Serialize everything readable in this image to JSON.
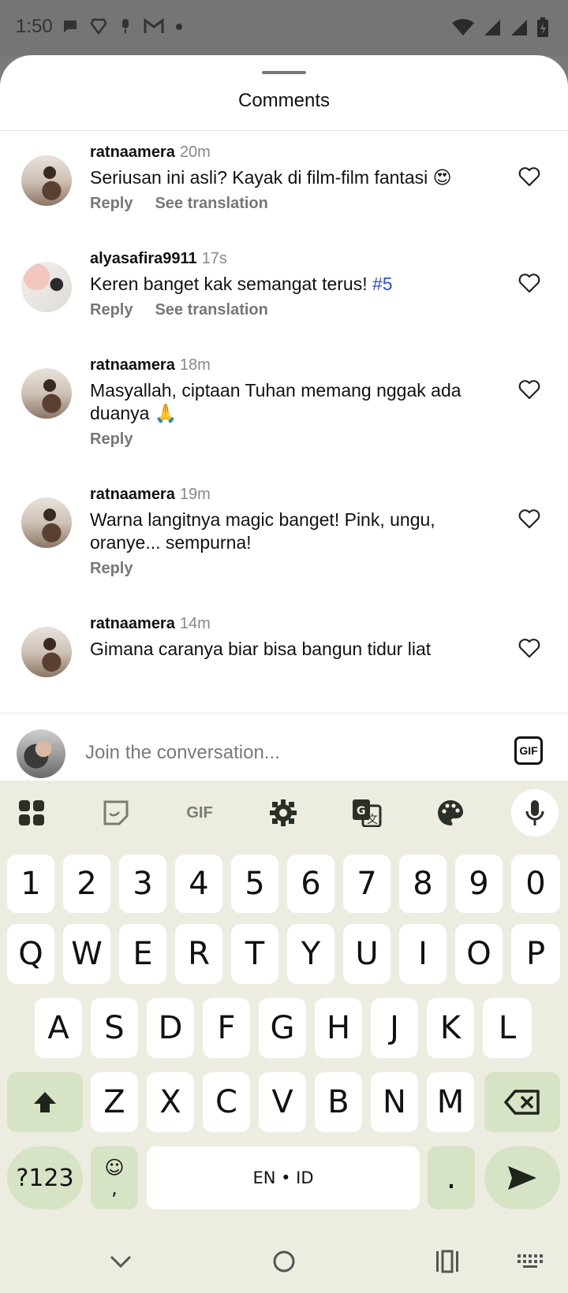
{
  "status_bar": {
    "time": "1:50",
    "left_icons": [
      "chat-bubble-icon",
      "brave-icon",
      "mic-notif-icon",
      "gmail-icon",
      "dot-icon"
    ],
    "right_icons": [
      "wifi-icon",
      "signal-icon",
      "signal-icon",
      "battery-icon"
    ]
  },
  "sheet": {
    "title": "Comments"
  },
  "comments": [
    {
      "user": "ratnaamera",
      "time": "20m",
      "text": "Seriusan ini asli? Kayak di film-film fantasi 😍",
      "reply": "Reply",
      "translate": "See translation"
    },
    {
      "user": "alyasafira9911",
      "time": "17s",
      "text": "Keren banget kak semangat terus! ",
      "hashtag": "#5",
      "reply": "Reply",
      "translate": "See translation"
    },
    {
      "user": "ratnaamera",
      "time": "18m",
      "text": "Masyallah, ciptaan Tuhan memang nggak ada duanya 🙏",
      "reply": "Reply"
    },
    {
      "user": "ratnaamera",
      "time": "19m",
      "text": "Warna langitnya magic banget! Pink, ungu, oranye... sempurna!",
      "reply": "Reply"
    },
    {
      "user": "ratnaamera",
      "time": "14m",
      "text": "Gimana caranya biar bisa bangun tidur liat"
    }
  ],
  "emoji_bar": [
    "❤️",
    "🙌",
    "🔥",
    "👏",
    "😢",
    "😍",
    "😮",
    "😂"
  ],
  "input": {
    "placeholder": "Join the conversation...",
    "gif_label": "GIF"
  },
  "keyboard": {
    "toolbar_gif": "GIF",
    "row_numbers": [
      "1",
      "2",
      "3",
      "4",
      "5",
      "6",
      "7",
      "8",
      "9",
      "0"
    ],
    "row_q": [
      "Q",
      "W",
      "E",
      "R",
      "T",
      "Y",
      "U",
      "I",
      "O",
      "P"
    ],
    "row_a": [
      "A",
      "S",
      "D",
      "F",
      "G",
      "H",
      "J",
      "K",
      "L"
    ],
    "row_z": [
      "Z",
      "X",
      "C",
      "V",
      "B",
      "N",
      "M"
    ],
    "sym_label": "?123",
    "emoji_comma": "☺\n,",
    "space_label": "EN • ID",
    "period_label": ".",
    "accent_color": "#d7e3c5",
    "background_color": "#ecede0"
  }
}
